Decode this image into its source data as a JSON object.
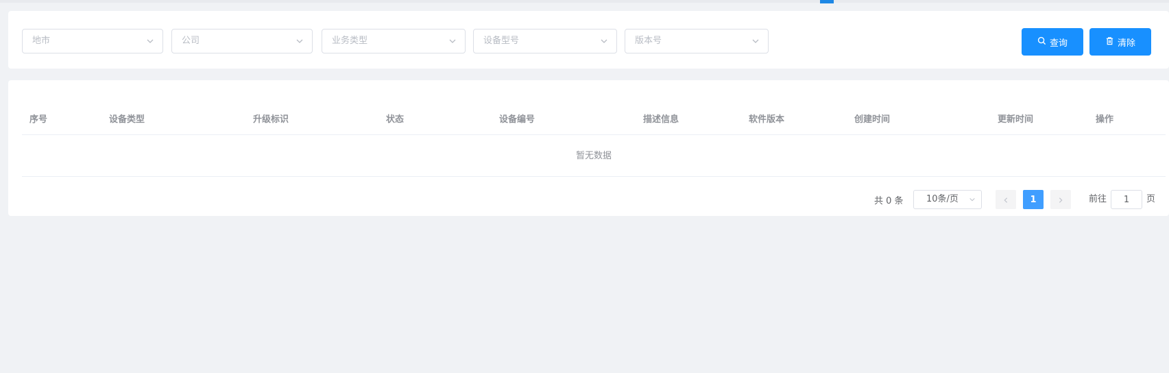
{
  "filters": [
    {
      "placeholder": "地市"
    },
    {
      "placeholder": "公司"
    },
    {
      "placeholder": "业务类型"
    },
    {
      "placeholder": "设备型号"
    },
    {
      "placeholder": "版本号"
    }
  ],
  "actions": {
    "query_label": "查询",
    "clear_label": "清除"
  },
  "table": {
    "columns": [
      "序号",
      "设备类型",
      "升级标识",
      "状态",
      "设备编号",
      "描述信息",
      "软件版本",
      "创建时间",
      "更新时间",
      "操作"
    ],
    "empty_text": "暂无数据"
  },
  "pagination": {
    "total_text": "共 0 条",
    "page_size": "10条/页",
    "current_page": "1",
    "goto_label": "前往",
    "goto_value": "1",
    "goto_suffix": "页"
  },
  "icons": {
    "dropdown": "chevron-down-icon",
    "search": "search-icon",
    "trash": "trash-icon",
    "prev": "chevron-left-icon",
    "next": "chevron-right-icon"
  },
  "colors": {
    "primary": "#1890ff",
    "page_active": "#409eff",
    "tab_indicator": "#1e88e5",
    "background": "#f0f2f5"
  }
}
